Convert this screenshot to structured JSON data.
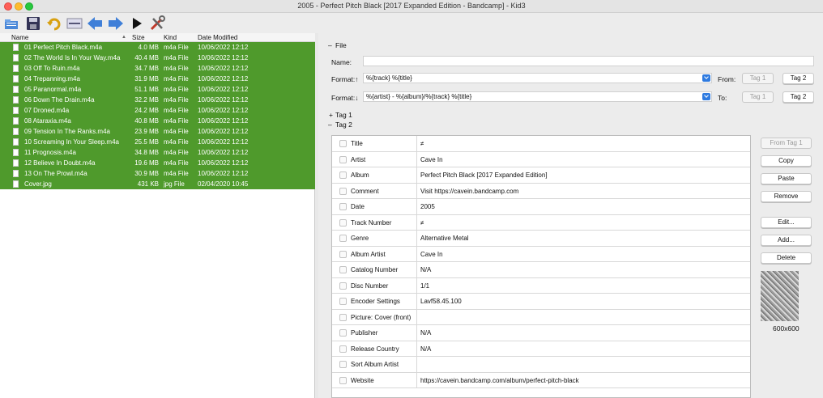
{
  "window": {
    "title": "2005 - Perfect Pitch Black [2017 Expanded Edition - Bandcamp] - Kid3"
  },
  "file_list": {
    "headers": {
      "name": "Name",
      "size": "Size",
      "kind": "Kind",
      "date": "Date Modified"
    },
    "rows": [
      {
        "name": "01 Perfect Pitch Black.m4a",
        "size": "4.0 MB",
        "kind": "m4a File",
        "date": "10/06/2022 12:12"
      },
      {
        "name": "02 The World Is In Your Way.m4a",
        "size": "40.4 MB",
        "kind": "m4a File",
        "date": "10/06/2022 12:12"
      },
      {
        "name": "03 Off To Ruin.m4a",
        "size": "34.7 MB",
        "kind": "m4a File",
        "date": "10/06/2022 12:12"
      },
      {
        "name": "04 Trepanning.m4a",
        "size": "31.9 MB",
        "kind": "m4a File",
        "date": "10/06/2022 12:12"
      },
      {
        "name": "05 Paranormal.m4a",
        "size": "51.1 MB",
        "kind": "m4a File",
        "date": "10/06/2022 12:12"
      },
      {
        "name": "06 Down The Drain.m4a",
        "size": "32.2 MB",
        "kind": "m4a File",
        "date": "10/06/2022 12:12"
      },
      {
        "name": "07 Droned.m4a",
        "size": "24.2 MB",
        "kind": "m4a File",
        "date": "10/06/2022 12:12"
      },
      {
        "name": "08 Ataraxia.m4a",
        "size": "40.8 MB",
        "kind": "m4a File",
        "date": "10/06/2022 12:12"
      },
      {
        "name": "09 Tension In The Ranks.m4a",
        "size": "23.9 MB",
        "kind": "m4a File",
        "date": "10/06/2022 12:12"
      },
      {
        "name": "10 Screaming In Your Sleep.m4a",
        "size": "25.5 MB",
        "kind": "m4a File",
        "date": "10/06/2022 12:12"
      },
      {
        "name": "11 Prognosis.m4a",
        "size": "34.8 MB",
        "kind": "m4a File",
        "date": "10/06/2022 12:12"
      },
      {
        "name": "12 Believe In Doubt.m4a",
        "size": "19.6 MB",
        "kind": "m4a File",
        "date": "10/06/2022 12:12"
      },
      {
        "name": "13 On The Prowl.m4a",
        "size": "30.9 MB",
        "kind": "m4a File",
        "date": "10/06/2022 12:12"
      },
      {
        "name": "Cover.jpg",
        "size": "431 KB",
        "kind": "jpg File",
        "date": "02/04/2020 10:45"
      }
    ],
    "selected_color": "#4f9a2c"
  },
  "file_section": {
    "toggle": "–",
    "title": "File",
    "name_label": "Name:",
    "name_value": "",
    "format_up_label": "Format:↑",
    "format_up_value": "%{track} %{title}",
    "format_down_label": "Format:↓",
    "format_down_value": "%{artist} - %{album}/%{track} %{title}",
    "from_label": "From:",
    "to_label": "To:",
    "tag1_button": "Tag 1",
    "tag2_button": "Tag 2"
  },
  "tag1_section": {
    "toggle": "+",
    "title": "Tag 1"
  },
  "tag2_section": {
    "toggle": "–",
    "title": "Tag 2",
    "frames": [
      {
        "name": "Title",
        "value": "≠"
      },
      {
        "name": "Artist",
        "value": "Cave In"
      },
      {
        "name": "Album",
        "value": "Perfect Pitch Black [2017 Expanded Edition]"
      },
      {
        "name": "Comment",
        "value": "Visit https://cavein.bandcamp.com"
      },
      {
        "name": "Date",
        "value": "2005"
      },
      {
        "name": "Track Number",
        "value": "≠"
      },
      {
        "name": "Genre",
        "value": "Alternative Metal"
      },
      {
        "name": "Album Artist",
        "value": "Cave In"
      },
      {
        "name": "Catalog Number",
        "value": "N/A"
      },
      {
        "name": "Disc Number",
        "value": "1/1"
      },
      {
        "name": "Encoder Settings",
        "value": "Lavf58.45.100"
      },
      {
        "name": "Picture: Cover (front)",
        "value": ""
      },
      {
        "name": "Publisher",
        "value": "N/A"
      },
      {
        "name": "Release Country",
        "value": "N/A"
      },
      {
        "name": "Sort Album Artist",
        "value": ""
      },
      {
        "name": "Website",
        "value": "https://cavein.bandcamp.com/album/perfect-pitch-black"
      }
    ],
    "buttons": {
      "from_tag1": "From Tag 1",
      "copy": "Copy",
      "paste": "Paste",
      "remove": "Remove",
      "edit": "Edit...",
      "add": "Add...",
      "delete": "Delete"
    },
    "cover_size": "600x600"
  },
  "toolbar_icons": [
    "open-folder-icon",
    "save-icon",
    "revert-icon",
    "settings-icon",
    "previous-icon",
    "next-icon",
    "play-icon",
    "tools-icon"
  ]
}
